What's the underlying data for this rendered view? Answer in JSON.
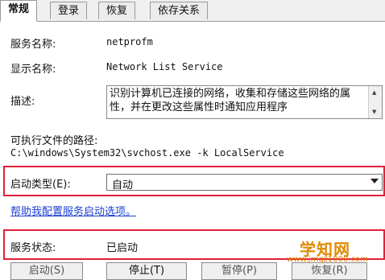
{
  "tabs": [
    {
      "label": "常规",
      "active": true
    },
    {
      "label": "登录",
      "active": false
    },
    {
      "label": "恢复",
      "active": false
    },
    {
      "label": "依存关系",
      "active": false
    }
  ],
  "service": {
    "name_label": "服务名称:",
    "name_value": "netprofm",
    "display_label": "显示名称:",
    "display_value": "Network List Service",
    "desc_label": "描述:",
    "desc_text": "识别计算机已连接的网络，收集和存储这些网络的属性，并在更改这些属性时通知应用程序",
    "exe_label": "可执行文件的路径:",
    "exe_path": "C:\\windows\\System32\\svchost.exe -k LocalService",
    "startup_label": "启动类型(E):",
    "startup_value": "自动",
    "help_link": "帮助我配置服务启动选项。",
    "status_label": "服务状态:",
    "status_value": "已启动"
  },
  "buttons": {
    "start": "启动(S)",
    "stop": "停止(T)",
    "pause": "暂停(P)",
    "resume": "恢复(R)"
  },
  "watermark": {
    "title": "学知网",
    "url": "www.jmqz1000.com"
  },
  "colors": {
    "highlight_border": "#e02038",
    "link": "#1a3fd4",
    "watermark": "#e08a00"
  }
}
